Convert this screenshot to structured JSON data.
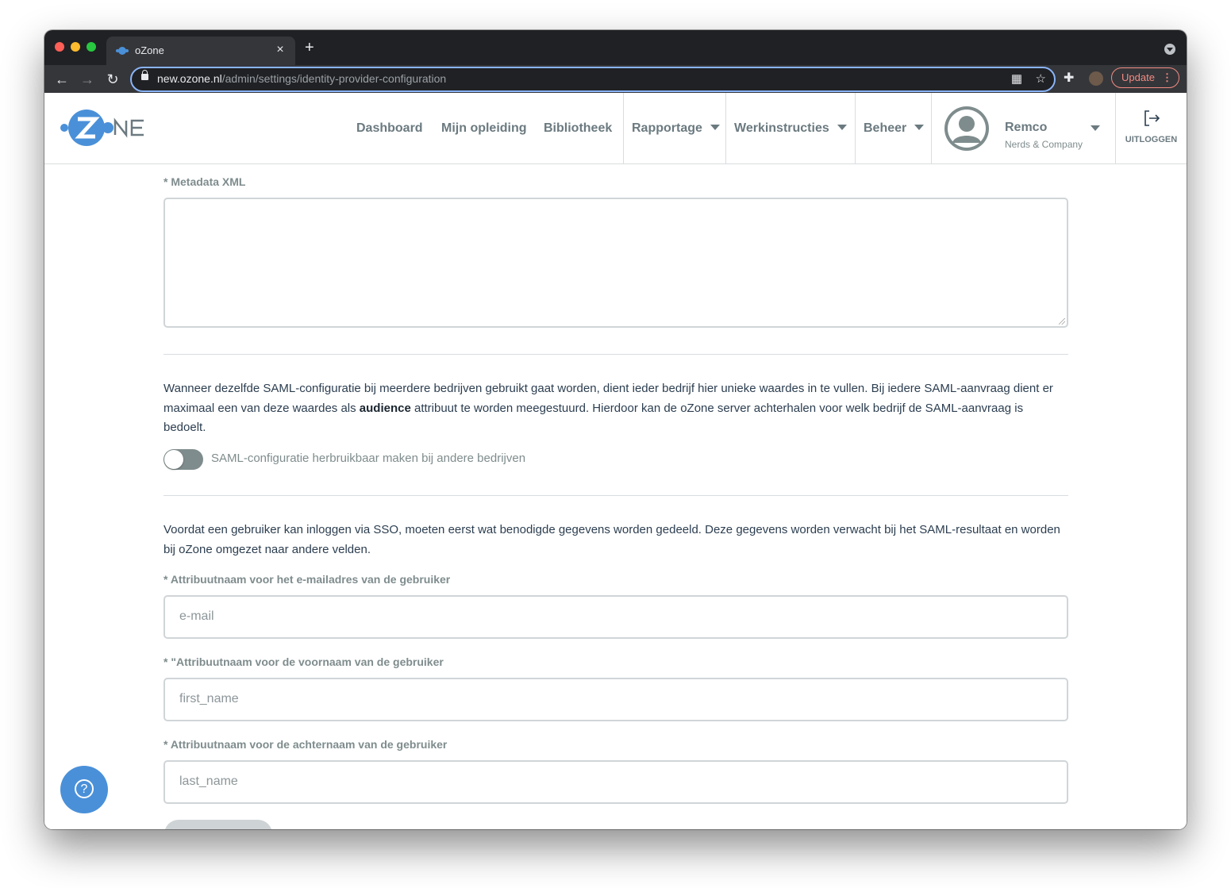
{
  "browser": {
    "tab_title": "oZone",
    "tab_close": "×",
    "new_tab": "+",
    "url_host": "new.ozone.nl",
    "url_path": "/admin/settings/identity-provider-configuration",
    "update_label": "Update",
    "update_menu": "⋮",
    "back": "←",
    "forward": "→",
    "reload": "↻",
    "qr_icon": "▦",
    "star_icon": "☆",
    "extensions_icon": "✚"
  },
  "header": {
    "logo_text": "oZone",
    "nav": [
      {
        "label": "Dashboard"
      },
      {
        "label": "Mijn opleiding"
      },
      {
        "label": "Bibliotheek"
      },
      {
        "label": "Rapportage"
      },
      {
        "label": "Werkinstructies"
      },
      {
        "label": "Beheer"
      }
    ],
    "user": {
      "name": "Remco",
      "company": "Nerds & Company"
    },
    "logout_label": "UITLOGGEN"
  },
  "form": {
    "metadata_label": "* Metadata XML",
    "metadata_value": "",
    "audience_text_before": "Wanneer dezelfde SAML-configuratie bij meerdere bedrijven gebruikt gaat worden, dient ieder bedrijf hier unieke waardes in te vullen. Bij iedere SAML-aanvraag dient er maximaal een van deze waardes als ",
    "audience_word": "audience",
    "audience_text_after": " attribuut te worden meegestuurd. Hierdoor kan de oZone server achterhalen voor welk bedrijf de SAML-aanvraag is bedoelt.",
    "toggle_label": "SAML-configuratie herbruikbaar maken bij andere bedrijven",
    "toggle_on": false,
    "sso_text": "Voordat een gebruiker kan inloggen via SSO, moeten eerst wat benodigde gegevens worden gedeeld. Deze gegevens worden verwacht bij het SAML-resultaat en worden bij oZone omgezet naar andere velden.",
    "email_label": "* Attribuutnaam voor het e-mailadres van de gebruiker",
    "email_placeholder": "e-mail",
    "firstname_label": "* \"Attribuutnaam voor de voornaam van de gebruiker",
    "firstname_placeholder": "first_name",
    "lastname_label": "* Attribuutnaam voor de achternaam van de gebruiker",
    "lastname_placeholder": "last_name"
  },
  "help": {
    "icon": "?"
  },
  "colors": {
    "accent": "#4a90d9",
    "text": "#2c3e50",
    "muted": "#7f8c8d",
    "update": "#f28b82"
  }
}
